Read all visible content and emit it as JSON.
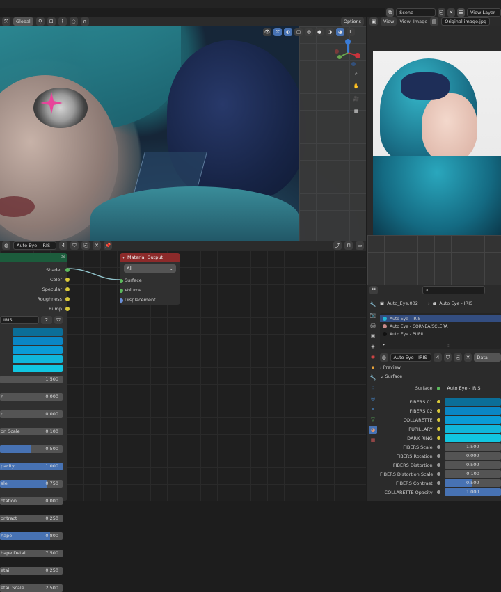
{
  "topbar": {
    "scene_label": "Scene",
    "view_layer_label": "View Layer"
  },
  "viewport_header": {
    "transform": "Global",
    "options": "Options"
  },
  "image_editor": {
    "view": "View",
    "view2": "View",
    "image": "Image",
    "image_name": "Original image.jpg"
  },
  "node_editor": {
    "material": "Auto Eye - IRIS",
    "users": "4"
  },
  "left_node": {
    "outputs": [
      "Shader",
      "Color",
      "Specular",
      "Roughness",
      "Bump"
    ],
    "group_name": "IRIS",
    "group_users": "2",
    "swatch_colors": [
      "#0b6e98",
      "#0a86c5",
      "#0a9bd6",
      "#10b6da",
      "#11c6e0"
    ],
    "fields": [
      {
        "label": "",
        "value": "1.500"
      },
      {
        "label": "n",
        "value": "0.000"
      },
      {
        "label": "n",
        "value": "0.000"
      },
      {
        "label": "on Scale",
        "value": "0.100"
      },
      {
        "label": "",
        "value": "0.500",
        "fill": 0.5
      },
      {
        "label": "pacity",
        "value": "1.000",
        "fill": 1.0
      },
      {
        "label": "ale",
        "value": "0.750",
        "fill": 0.75
      },
      {
        "label": "otation",
        "value": "0.000"
      },
      {
        "label": "ontract",
        "value": "0.250"
      },
      {
        "label": "hape",
        "value": "0.800",
        "fill": 0.8
      },
      {
        "label": "hape Detail",
        "value": "7.500"
      },
      {
        "label": "etail",
        "value": "0.250"
      },
      {
        "label": "etail Scale",
        "value": "2.500"
      }
    ]
  },
  "material_output": {
    "title": "Material Output",
    "target": "All",
    "inputs": [
      "Surface",
      "Volume",
      "Displacement"
    ]
  },
  "properties": {
    "object_name": "Auto_Eye.002",
    "material_name": "Auto Eye - IRIS",
    "slots": [
      {
        "name": "Auto Eye - IRIS",
        "color": "#22b5d6"
      },
      {
        "name": "Auto Eye - CORNEA/SCLERA",
        "color": "#c98a8a"
      },
      {
        "name": "Auto Eye - PUPIL",
        "color": "#111111"
      }
    ],
    "material_field": "Auto Eye - IRIS",
    "material_users": "4",
    "data_label": "Data",
    "preview_label": "Preview",
    "surface_label": "Surface",
    "surface_row": {
      "label": "Surface",
      "value": "Auto Eye - IRIS"
    },
    "colors": [
      {
        "label": "FIBERS 01",
        "color": "#0b6e98"
      },
      {
        "label": "FIBERS 02",
        "color": "#0a86c5"
      },
      {
        "label": "COLLARETTE",
        "color": "#0a9bd6"
      },
      {
        "label": "PUPILLARY",
        "color": "#10b6da"
      },
      {
        "label": "DARK RING",
        "color": "#11c6e0"
      }
    ],
    "values": [
      {
        "label": "FIBERS Scale",
        "value": "1.500"
      },
      {
        "label": "FIBERS Rotation",
        "value": "0.000"
      },
      {
        "label": "FIBERS Distortion",
        "value": "0.500"
      },
      {
        "label": "FIBERS Distortion Scale",
        "value": "0.100"
      },
      {
        "label": "FIBERS Contrast",
        "value": "0.500",
        "fill": 0.5
      },
      {
        "label": "COLLARETTE Opacity",
        "value": "1.000",
        "fill": 1.0
      }
    ]
  }
}
